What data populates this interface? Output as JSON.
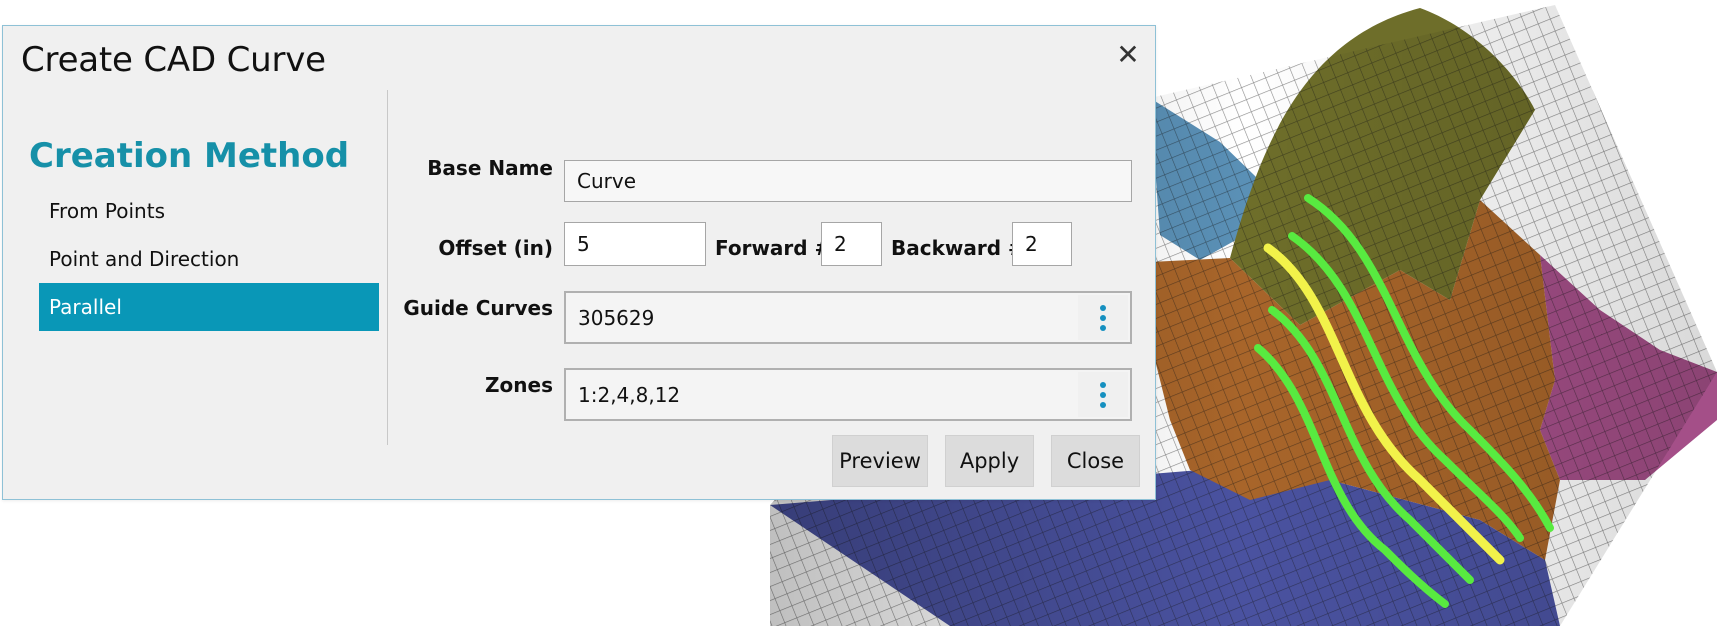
{
  "dialog": {
    "title": "Create CAD Curve",
    "close_icon": "close-icon"
  },
  "creation_method": {
    "heading": "Creation Method",
    "items": [
      {
        "label": "From Points",
        "selected": false
      },
      {
        "label": "Point and Direction",
        "selected": false
      },
      {
        "label": "Parallel",
        "selected": true
      }
    ]
  },
  "form": {
    "base_name": {
      "label": "Base Name",
      "value": "Curve"
    },
    "offset": {
      "label": "Offset (in)",
      "value": "5"
    },
    "forward": {
      "label": "Forward #",
      "value": "2"
    },
    "backward": {
      "label": "Backward #",
      "value": "2"
    },
    "guide_curves": {
      "label": "Guide Curves",
      "value": "305629"
    },
    "zones": {
      "label": "Zones",
      "value": "1:2,4,8,12"
    },
    "more_icon": "more-vertical-icon"
  },
  "buttons": {
    "preview": "Preview",
    "apply": "Apply",
    "close": "Close"
  },
  "colors": {
    "accent": "#0997b7",
    "heading": "#1690a8",
    "dialog_bg": "#f0f0f0",
    "mesh_olive": "#6e6e2a",
    "mesh_brown": "#a8652a",
    "mesh_blue": "#4a52a0",
    "mesh_steel": "#5a90b6",
    "mesh_magenta": "#a44f88",
    "curve_green": "#58ea40",
    "curve_yellow": "#f2f24a"
  }
}
